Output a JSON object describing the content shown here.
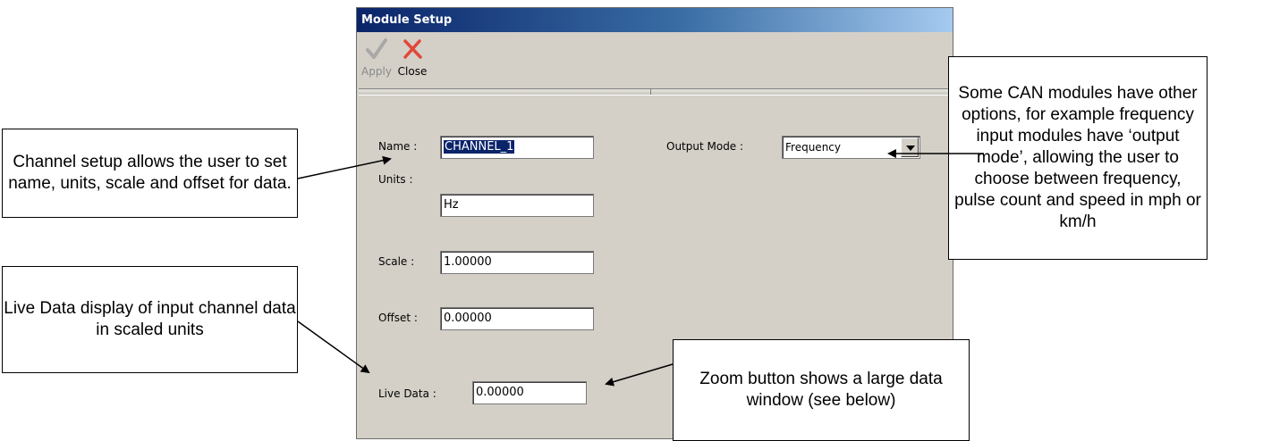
{
  "dialog": {
    "title": "Module Setup",
    "toolbar": {
      "apply_label": "Apply",
      "close_label": "Close"
    },
    "fields": {
      "name_label": "Name :",
      "name_value": "CHANNEL_1",
      "units_label": "Units :",
      "units_value": "Hz",
      "scale_label": "Scale :",
      "scale_value": "1.00000",
      "offset_label": "Offset :",
      "offset_value": "0.00000",
      "live_label": "Live Data :",
      "live_value": "0.00000",
      "output_mode_label": "Output Mode :",
      "output_mode_value": "Frequency"
    }
  },
  "callouts": {
    "channel_setup": "Channel setup allows the user to set name, units, scale and offset for data.",
    "live_data": "Live Data display of input channel data in scaled units",
    "can_modules": "Some CAN modules have other options, for example frequency input modules have ‘output mode’, allowing the user to choose between frequency, pulse count and speed in mph or km/h",
    "zoom": "Zoom button shows a large data window (see below)"
  },
  "colors": {
    "title_gradient_start": "#0a246a",
    "title_gradient_end": "#a6caf0",
    "dialog_bg": "#d4d0c8",
    "close_icon": "#e0483a",
    "apply_icon": "#a8a8a8"
  },
  "icons": {
    "apply": "check-icon",
    "close": "x-icon",
    "zoom": "magnifier-icon"
  }
}
